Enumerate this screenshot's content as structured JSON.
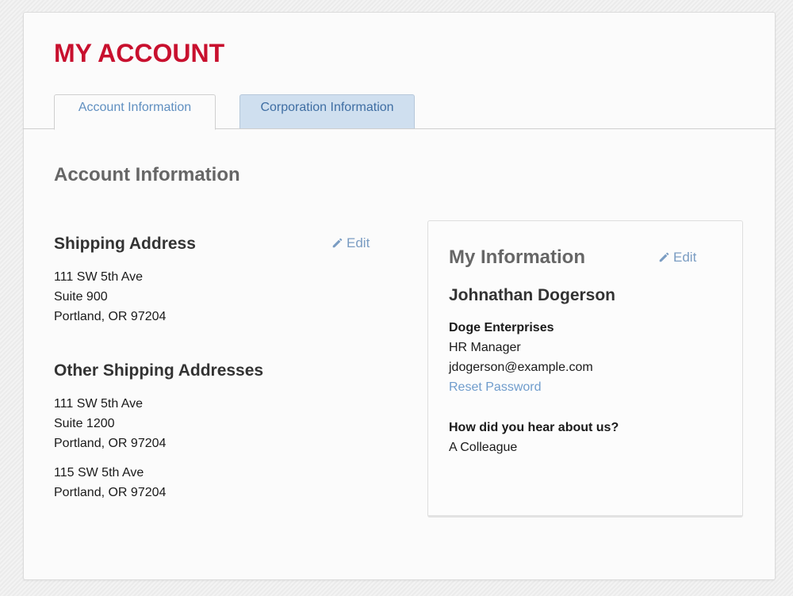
{
  "page": {
    "title": "MY ACCOUNT"
  },
  "tabs": [
    {
      "label": "Account Information",
      "active": true
    },
    {
      "label": "Corporation Information",
      "active": false
    }
  ],
  "section": {
    "title": "Account Information"
  },
  "shipping": {
    "title": "Shipping Address",
    "edit_label": "Edit",
    "address": {
      "line1": "111 SW 5th Ave",
      "line2": "Suite 900",
      "line3": "Portland, OR 97204"
    }
  },
  "other_shipping": {
    "title": "Other Shipping Addresses",
    "addresses": [
      {
        "line1": "111 SW 5th Ave",
        "line2": "Suite 1200",
        "line3": "Portland, OR 97204"
      },
      {
        "line1": "115 SW 5th Ave",
        "line2": "Portland, OR 97204"
      }
    ]
  },
  "my_info": {
    "title": "My Information",
    "edit_label": "Edit",
    "name": "Johnathan Dogerson",
    "company": "Doge Enterprises",
    "role": "HR Manager",
    "email": "jdogerson@example.com",
    "reset_password_label": "Reset Password",
    "hear_question": "How did you hear about us?",
    "hear_answer": "A Colleague"
  },
  "colors": {
    "brand_red": "#c8102e",
    "link_blue": "#6f9ccc",
    "inactive_tab_bg": "#cfdfef"
  },
  "icons": {
    "edit": "pencil-icon"
  }
}
